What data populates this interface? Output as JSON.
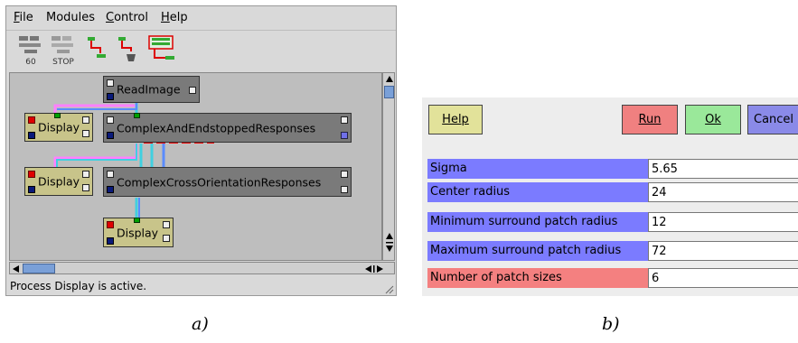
{
  "window_a": {
    "menu": {
      "file": "File",
      "modules": "Modules",
      "control": "Control",
      "help": "Help"
    },
    "toolbar": {
      "tool1_label": "60",
      "tool2_label": "STOP"
    },
    "modules": {
      "read_image": "ReadImage",
      "display1": "Display",
      "complex_end": "ComplexAndEndstoppedResponses",
      "display2": "Display",
      "complex_cross": "ComplexCrossOrientationResponses",
      "display3": "Display"
    },
    "status_text": "Process Display is active."
  },
  "window_b": {
    "buttons": {
      "help": "Help",
      "run": "Run",
      "ok": "Ok",
      "cancel": "Cancel"
    },
    "params": [
      {
        "label": "Sigma",
        "value": "5.65",
        "color": "#7b7bff"
      },
      {
        "label": "Center radius",
        "value": "24",
        "color": "#7b7bff"
      },
      {
        "label": "Minimum surround patch radius",
        "value": "12",
        "color": "#7b7bff"
      },
      {
        "label": "Maximum surround patch radius",
        "value": "72",
        "color": "#7b7bff"
      },
      {
        "label": "Number of patch sizes",
        "value": "6",
        "color": "#f48080"
      }
    ]
  },
  "captions": {
    "a": "a)",
    "b": "b)"
  },
  "colors": {
    "pipe_pink": "#ff80ff",
    "pipe_cyan": "#40d0e0",
    "pipe_blue": "#5a8cff",
    "btn_help": "#e2e29a",
    "btn_run": "#f08080",
    "btn_ok": "#9ae89a",
    "btn_cancel": "#8a8ae8"
  }
}
